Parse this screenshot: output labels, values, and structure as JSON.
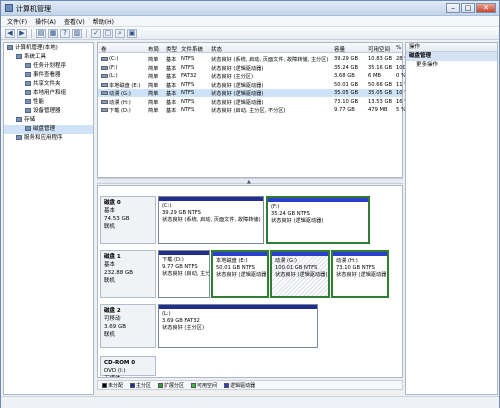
{
  "window": {
    "title": "计算机管理"
  },
  "menu": [
    "文件(F)",
    "操作(A)",
    "查看(V)",
    "帮助(H)"
  ],
  "tree": [
    {
      "label": "计算机管理(本地)",
      "indent": 0
    },
    {
      "label": "系统工具",
      "indent": 1
    },
    {
      "label": "任务计划程序",
      "indent": 2
    },
    {
      "label": "事件查看器",
      "indent": 2
    },
    {
      "label": "共享文件夹",
      "indent": 2
    },
    {
      "label": "本地用户和组",
      "indent": 2
    },
    {
      "label": "性能",
      "indent": 2
    },
    {
      "label": "设备管理器",
      "indent": 2
    },
    {
      "label": "存储",
      "indent": 1
    },
    {
      "label": "磁盘管理",
      "indent": 2,
      "selected": true
    },
    {
      "label": "服务和应用程序",
      "indent": 1
    }
  ],
  "list": {
    "headers": [
      "卷",
      "布局",
      "类型",
      "文件系统",
      "状态",
      "容量",
      "可用空间",
      "%"
    ],
    "rows": [
      [
        "(C:)",
        "简单",
        "基本",
        "NTFS",
        "状态良好 (系统, 启动, 页面文件, 故障转储, 主分区)",
        "39.29 GB",
        "10.83 GB",
        "28 %"
      ],
      [
        "(F:)",
        "简单",
        "基本",
        "NTFS",
        "状态良好 (逻辑驱动器)",
        "35.24 GB",
        "35.16 GB",
        "100 %"
      ],
      [
        "(L:)",
        "简单",
        "基本",
        "FAT32",
        "状态良好 (主分区)",
        "3.68 GB",
        "6 MB",
        "0 %"
      ],
      [
        "本地磁盘 (E:)",
        "简单",
        "基本",
        "NTFS",
        "状态良好 (逻辑驱动器)",
        "50.01 GB",
        "50.66 GB",
        "11 %"
      ],
      [
        "动漫 (G:)",
        "简单",
        "基本",
        "NTFS",
        "状态良好 (逻辑驱动器)",
        "35.05 GB",
        "35.05 GB",
        "10 %"
      ],
      [
        "动漫 (H:)",
        "简单",
        "基本",
        "NTFS",
        "状态良好 (逻辑驱动器)",
        "73.10 GB",
        "13.53 GB",
        "16 %"
      ],
      [
        "下载 (D:)",
        "简单",
        "基本",
        "NTFS",
        "状态良好 (启动, 主分区, 不分区)",
        "9.77 GB",
        "479 MB",
        "5 %"
      ]
    ],
    "selected_row": 4
  },
  "disks": [
    {
      "name": "磁盘 0",
      "type": "基本",
      "size": "74.53 GB",
      "status": "联机",
      "partitions": [
        {
          "name": "(C:)",
          "info": "39.29 GB NTFS",
          "status": "状态良好 (系统, 启动, 页面文件, 故障转储)",
          "bar": "#1f2d8c",
          "selected": false
        },
        {
          "name": "(F:)",
          "info": "35.24 GB NTFS",
          "status": "状态良好 (逻辑驱动器)",
          "bar": "#2a3fcc",
          "selected": true
        }
      ]
    },
    {
      "name": "磁盘 1",
      "type": "基本",
      "size": "232.88 GB",
      "status": "联机",
      "partitions": [
        {
          "name": "下载 (D:)",
          "info": "9.77 GB NTFS",
          "status": "状态良好 (启动, 主分区)",
          "bar": "#1f2d8c",
          "selected": false
        },
        {
          "name": "本地磁盘 (E:)",
          "info": "50.01 GB NTFS",
          "status": "状态良好 (逻辑驱动器)",
          "bar": "#2a3fcc",
          "selected": true
        },
        {
          "name": "动漫 (G:)",
          "info": "100.01 GB NTFS",
          "status": "状态良好 (逻辑驱动器)",
          "bar": "#2a3fcc",
          "selected": true,
          "hatch": true
        },
        {
          "name": "动漫 (H:)",
          "info": "73.10 GB NTFS",
          "status": "状态良好 (逻辑驱动器)",
          "bar": "#2a3fcc",
          "selected": true
        }
      ]
    },
    {
      "name": "磁盘 2",
      "type": "可移动",
      "size": "3.69 GB",
      "status": "联机",
      "partitions": [
        {
          "name": "(L:)",
          "info": "3.69 GB FAT32",
          "status": "状态良好 (主分区)",
          "bar": "#1f2d8c",
          "selected": false
        }
      ]
    },
    {
      "name": "CD-ROM 0",
      "type": "DVD (I:)",
      "size": "",
      "status": "无媒体",
      "partitions": []
    }
  ],
  "legend": [
    {
      "label": "未分配",
      "color": "#000000"
    },
    {
      "label": "主分区",
      "color": "#1f2d8c"
    },
    {
      "label": "扩展分区",
      "color": "#2e9e2e"
    },
    {
      "label": "可用空间",
      "color": "#3fbf3f"
    },
    {
      "label": "逻辑驱动器",
      "color": "#2a3fcc"
    }
  ],
  "actions": {
    "header": "操作",
    "section": "磁盘管理",
    "items": [
      "更多操作"
    ]
  }
}
